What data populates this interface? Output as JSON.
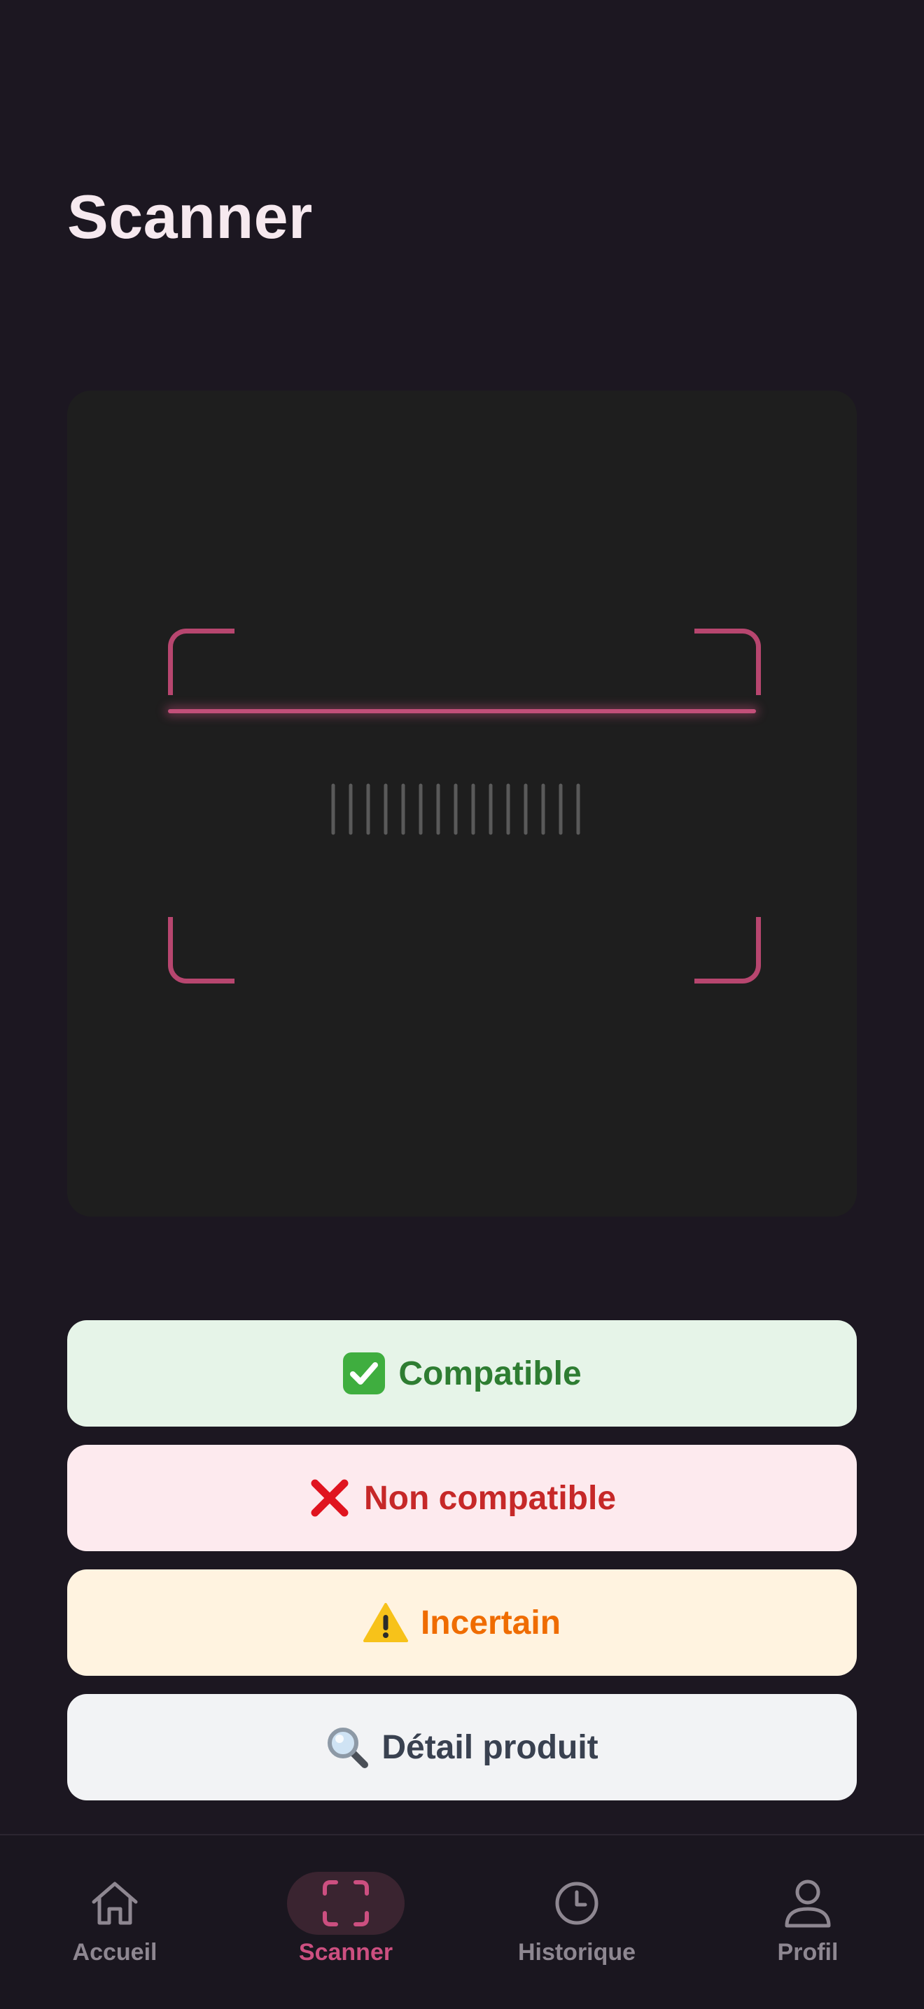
{
  "header": {
    "title": "Scanner"
  },
  "scanner": {
    "frame_color": "#1e1e1e",
    "accent_color": "#b7466f",
    "icon": "barcode-icon"
  },
  "status_buttons": [
    {
      "icon": "check-mark-button-icon",
      "emoji": "✅",
      "label": "Compatible",
      "bg": "#e6f4e8",
      "color": "#2e7d32"
    },
    {
      "icon": "cross-mark-icon",
      "emoji": "❌",
      "label": "Non compatible",
      "bg": "#fdeaee",
      "color": "#c62828"
    },
    {
      "icon": "warning-icon",
      "emoji": "⚠️",
      "label": "Incertain",
      "bg": "#fff3e0",
      "color": "#ef6c00"
    },
    {
      "icon": "magnifying-glass-icon",
      "emoji": "🔍",
      "label": "Détail produit",
      "bg": "#f2f3f5",
      "color": "#394150"
    }
  ],
  "bottom_nav": {
    "active": "Scanner",
    "active_color": "#cc4f80",
    "items": [
      {
        "icon": "home-icon",
        "label": "Accueil"
      },
      {
        "icon": "scan-frame-icon",
        "label": "Scanner"
      },
      {
        "icon": "clock-icon",
        "label": "Historique"
      },
      {
        "icon": "user-icon",
        "label": "Profil"
      }
    ]
  }
}
